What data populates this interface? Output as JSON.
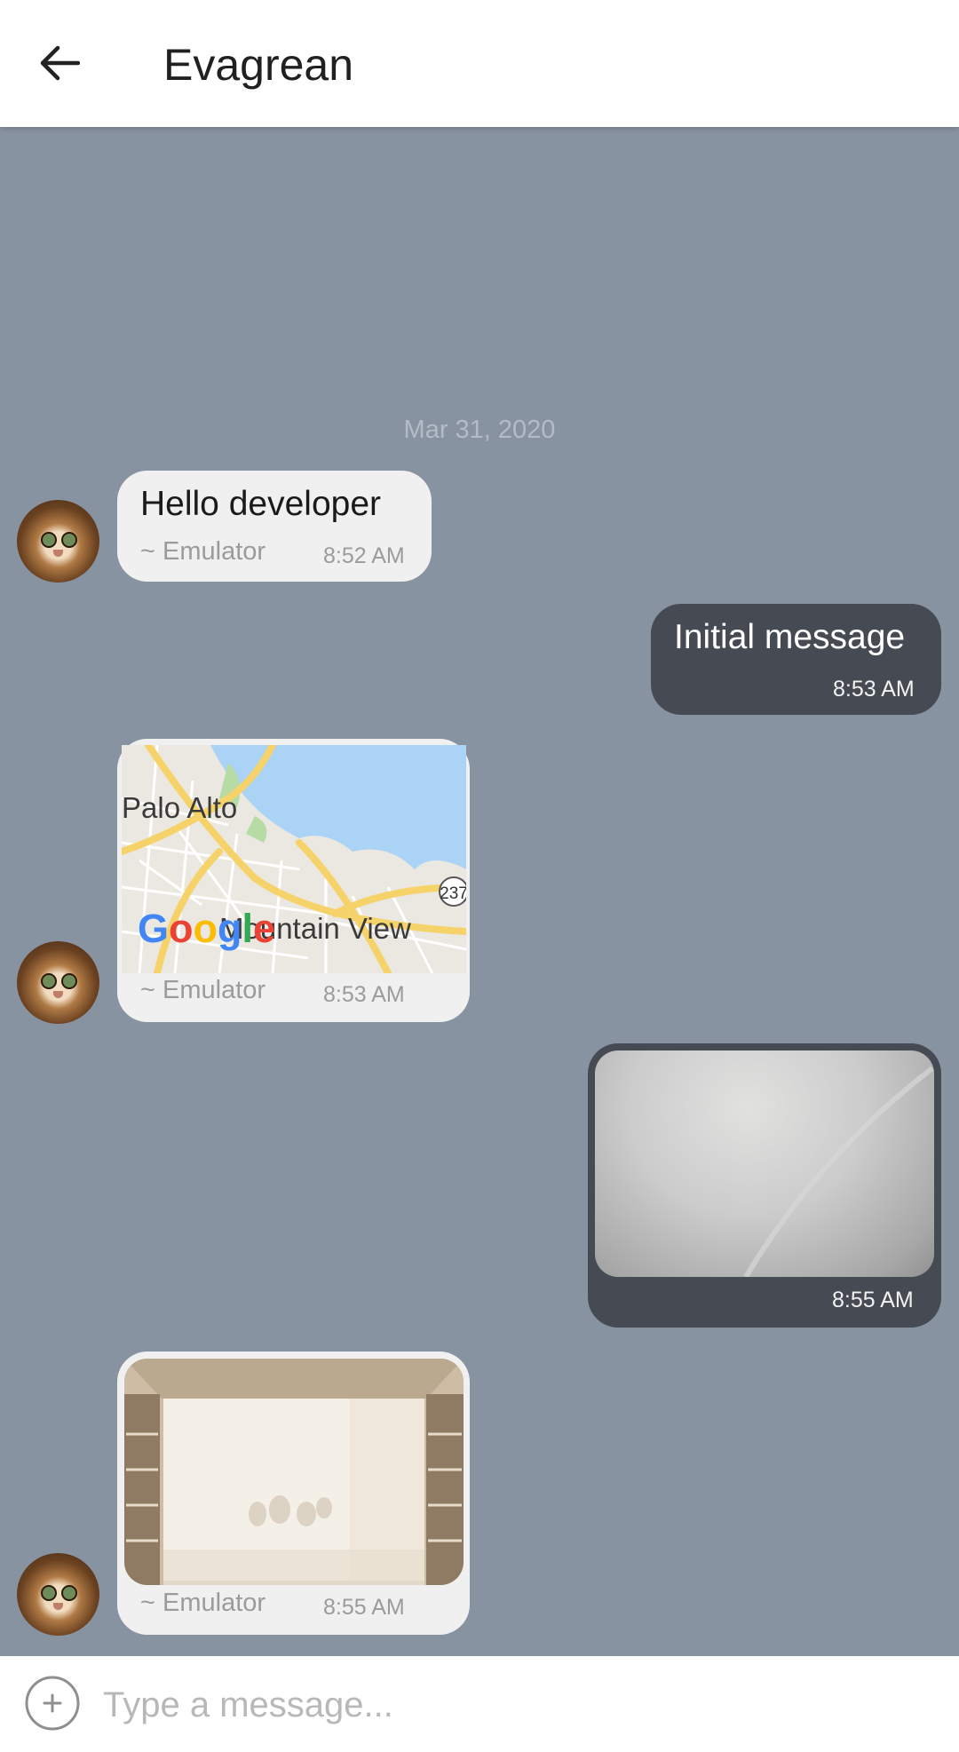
{
  "header": {
    "title": "Evagrean"
  },
  "date_separator": "Mar 31, 2020",
  "messages": [
    {
      "direction": "incoming",
      "type": "text",
      "text": "Hello developer",
      "sender": "~ Emulator",
      "time": "8:52 AM"
    },
    {
      "direction": "outgoing",
      "type": "text",
      "text": "Initial message",
      "time": "8:53 AM"
    },
    {
      "direction": "incoming",
      "type": "location",
      "map_labels": [
        "Palo Alto",
        "Mountain View",
        "237"
      ],
      "map_brand": "Google",
      "sender": "~ Emulator",
      "time": "8:53 AM"
    },
    {
      "direction": "outgoing",
      "type": "image",
      "time": "8:55 AM"
    },
    {
      "direction": "incoming",
      "type": "image",
      "sender": "~ Emulator",
      "time": "8:55 AM"
    }
  ],
  "composer": {
    "placeholder": "Type a message..."
  },
  "colors": {
    "chat_background": "#8893a2",
    "outgoing_bubble": "#464a52",
    "incoming_bubble": "#f0f0f0"
  }
}
